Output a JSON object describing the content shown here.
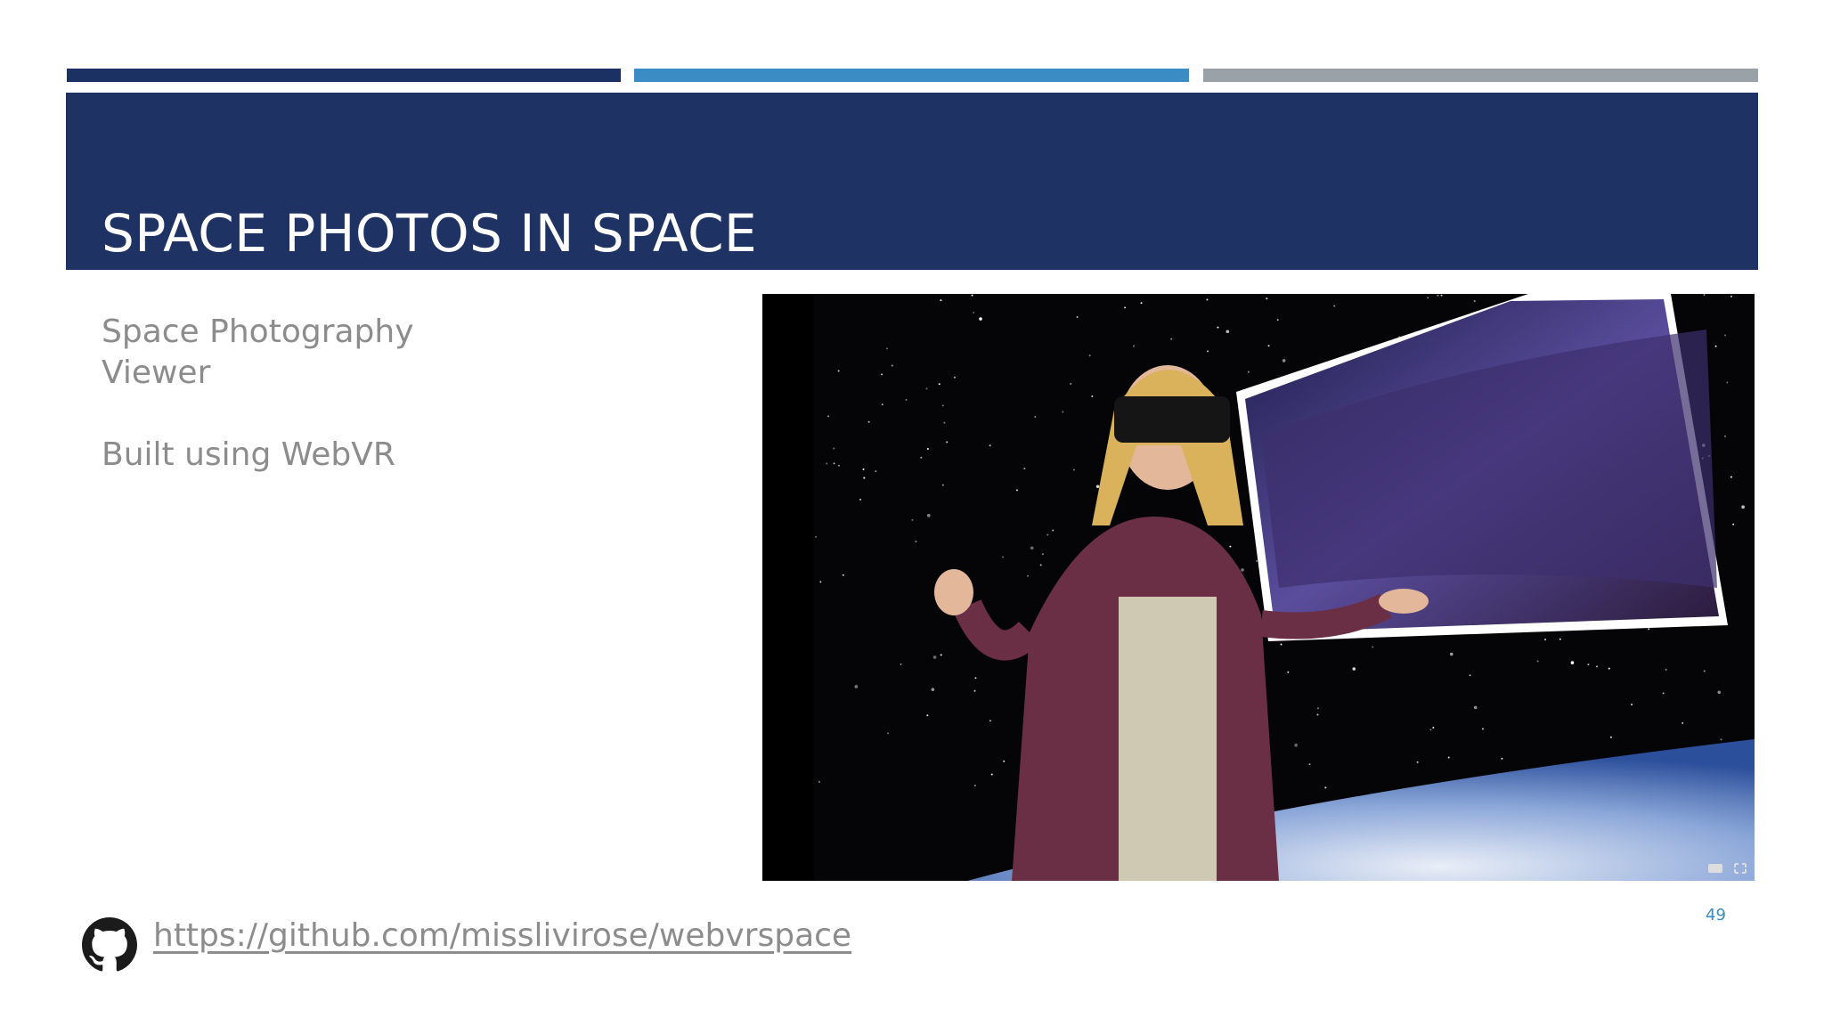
{
  "colors": {
    "bar_dark": "#1c3163",
    "bar_blue": "#3b8bc4",
    "bar_gray": "#9aa2a8",
    "title_band": "#1f3264",
    "body_text": "#8c8c8c",
    "page_number": "#3b8bc4"
  },
  "slide": {
    "title": "SPACE PHOTOS IN SPACE",
    "body_line_1a": "Space Photography",
    "body_line_1b": "Viewer",
    "body_line_2": "Built using WebVR",
    "page_number": "49"
  },
  "video": {
    "icons": [
      "cardboard-vr-icon",
      "fullscreen-icon"
    ]
  },
  "footer": {
    "icon": "github-icon",
    "link_text": "https://github.com/misslivirose/webvrspace"
  }
}
